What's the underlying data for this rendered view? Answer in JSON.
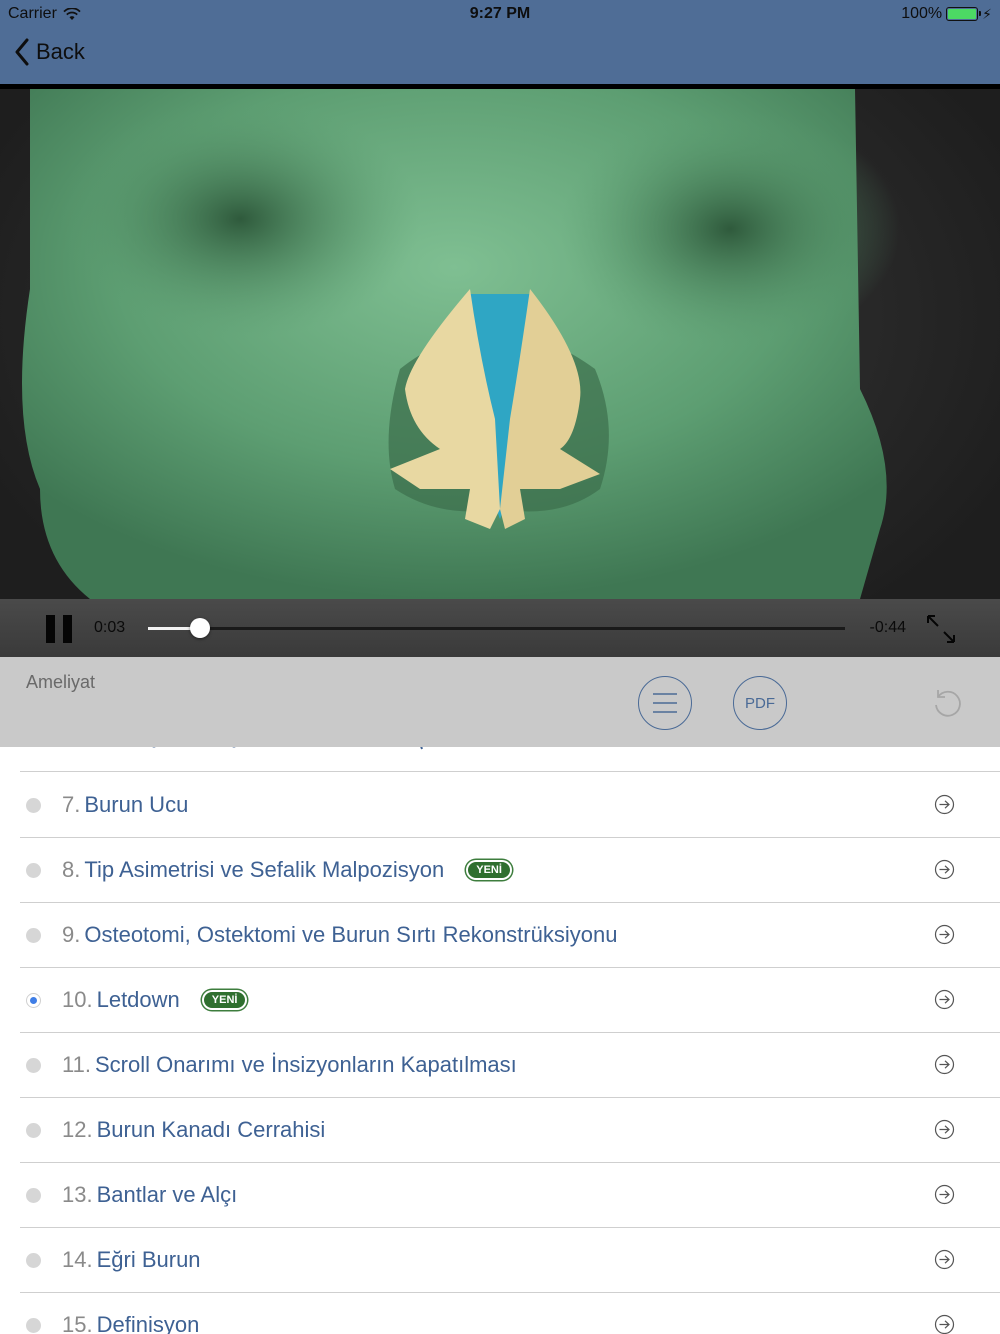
{
  "status_bar": {
    "carrier": "Carrier",
    "time": "9:27 PM",
    "battery": "100%"
  },
  "nav": {
    "back_label": "Back"
  },
  "player": {
    "elapsed": "0:03",
    "remaining": "-0:44",
    "progress": 0.074
  },
  "toolbar": {
    "section_label": "Ameliyat",
    "pdf_label": "PDF"
  },
  "colors": {
    "nav_bg": "#4f6d96",
    "accent": "#3e6193",
    "badge": "#2f6f2f",
    "active_dot": "#3f7ee6"
  },
  "lessons": [
    {
      "num": "7.",
      "title": "Burun Ucu",
      "badge": "",
      "active": false
    },
    {
      "num": "8.",
      "title": "Tip Asimetrisi ve Sefalik Malpozisyon",
      "badge": "YENİ",
      "active": false
    },
    {
      "num": "9.",
      "title": "Osteotomi, Ostektomi ve Burun Sırtı Rekonstrüksiyonu",
      "badge": "",
      "active": false
    },
    {
      "num": "10.",
      "title": "Letdown",
      "badge": "YENİ",
      "active": true
    },
    {
      "num": "11.",
      "title": "Scroll Onarımı ve İnsizyonların Kapatılması",
      "badge": "",
      "active": false
    },
    {
      "num": "12.",
      "title": "Burun Kanadı Cerrahisi",
      "badge": "",
      "active": false
    },
    {
      "num": "13.",
      "title": "Bantlar ve Alçı",
      "badge": "",
      "active": false
    },
    {
      "num": "14.",
      "title": "Eğri Burun",
      "badge": "",
      "active": false
    },
    {
      "num": "15.",
      "title": "Definisyon",
      "badge": "",
      "active": false
    }
  ]
}
